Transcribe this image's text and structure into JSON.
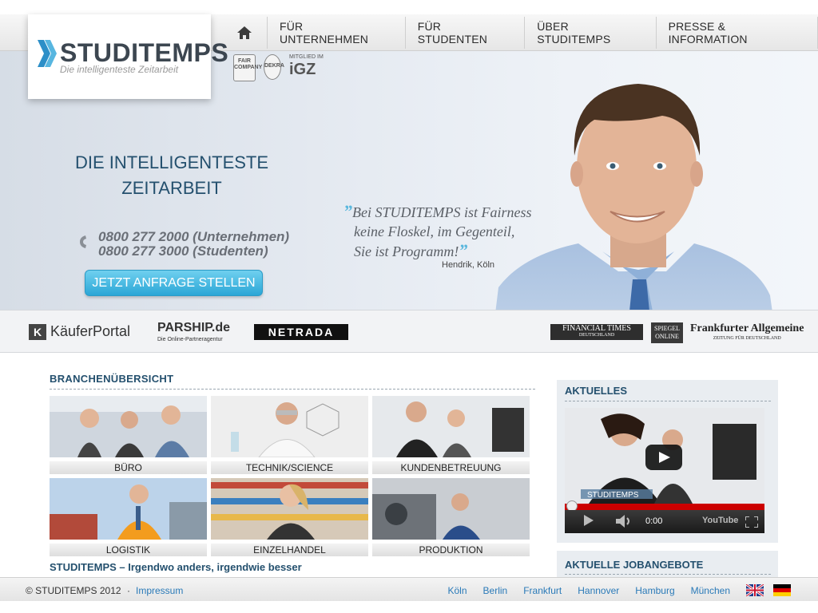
{
  "nav": {
    "home_icon": "home-icon",
    "items": [
      "FÜR UNTERNEHMEN",
      "FÜR STUDENTEN",
      "ÜBER STUDITEMPS",
      "PRESSE & INFORMATION"
    ]
  },
  "logo": {
    "name": "STUDITEMPS",
    "tagline": "Die intelligenteste Zeitarbeit"
  },
  "badges": {
    "fair": "FAIR COMPANY",
    "dekra": "DEKRA",
    "igz_caption": "MITGLIED IM",
    "igz": "iGZ"
  },
  "hero": {
    "headline_1": "DIE INTELLIGENTESTE",
    "headline_2": "ZEITARBEIT",
    "phone_1": "0800 277 2000 (Unternehmen)",
    "phone_2": "0800 277 3000 (Studenten)",
    "cta": "JETZT ANFRAGE STELLEN",
    "quote_1": "Bei STUDITEMPS ist Fairness",
    "quote_2": "keine Floskel, im Gegenteil,",
    "quote_3": "Sie ist Programm!",
    "author": "Hendrik, Köln"
  },
  "partners": {
    "kaeufer": "KäuferPortal",
    "parship": "PARSHIP.de",
    "parship_sub": "Die Online-Partneragentur",
    "netrada": "NETRADA",
    "ft": "FINANCIAL TIMES",
    "ft_sub": "DEUTSCHLAND",
    "spiegel_1": "SPIEGEL",
    "spiegel_2": "ONLINE",
    "faz": "Frankfurter Allgemeine",
    "faz_sub": "ZEITUNG FÜR DEUTSCHLAND"
  },
  "branchen": {
    "title": "BRANCHENÜBERSICHT",
    "tiles": [
      "BÜRO",
      "TECHNIK/SCIENCE",
      "KUNDENBETREUUNG",
      "LOGISTIK",
      "EINZELHANDEL",
      "PRODUKTION"
    ]
  },
  "slogan": "STUDITEMPS – Irgendwo anders, irgendwie besser",
  "sidebar": {
    "aktuelles": "AKTUELLES",
    "video_time": "0:00",
    "video_brand": "STUDITEMPS",
    "youtube": "YouTube",
    "jobangebote": "AKTUELLE JOBANGEBOTE"
  },
  "footer": {
    "copyright": "© STUDITEMPS 2012",
    "impressum": "Impressum",
    "cities": [
      "Köln",
      "Berlin",
      "Frankfurt",
      "Hannover",
      "Hamburg",
      "München"
    ],
    "flags": [
      "uk-flag-icon",
      "german-flag-icon"
    ]
  },
  "colors": {
    "accent": "#24506e",
    "cta": "#2ba6d6",
    "link": "#2a7ab8"
  }
}
